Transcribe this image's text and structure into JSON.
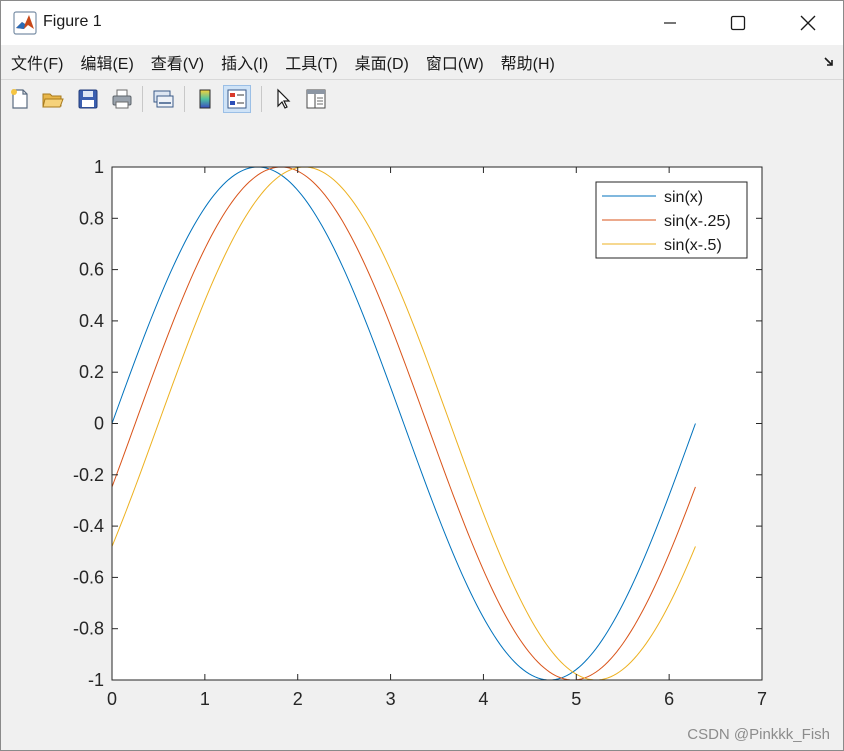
{
  "window": {
    "title": "Figure 1",
    "controls": [
      "minimize-icon",
      "maximize-icon",
      "close-icon"
    ]
  },
  "menubar": {
    "items": [
      {
        "label": "文件(F)"
      },
      {
        "label": "编辑(E)"
      },
      {
        "label": "查看(V)"
      },
      {
        "label": "插入(I)"
      },
      {
        "label": "工具(T)"
      },
      {
        "label": "桌面(D)"
      },
      {
        "label": "窗口(W)"
      },
      {
        "label": "帮助(H)"
      }
    ]
  },
  "toolbar": {
    "buttons": [
      {
        "icon": "new-figure-icon"
      },
      {
        "icon": "open-file-icon"
      },
      {
        "icon": "save-icon"
      },
      {
        "icon": "print-icon"
      },
      {
        "icon": "link-plot-icon"
      },
      {
        "icon": "colorbar-icon"
      },
      {
        "icon": "legend-icon",
        "active": true
      },
      {
        "icon": "edit-plot-pointer-icon"
      },
      {
        "icon": "property-inspector-icon"
      }
    ]
  },
  "chart_data": {
    "type": "line",
    "title": "",
    "xlabel": "",
    "ylabel": "",
    "xlim": [
      0,
      7
    ],
    "ylim": [
      -1,
      1
    ],
    "xticks": [
      "0",
      "1",
      "2",
      "3",
      "4",
      "5",
      "6",
      "7"
    ],
    "yticks": [
      "-1",
      "-0.8",
      "-0.6",
      "-0.4",
      "-0.2",
      "0",
      "0.2",
      "0.4",
      "0.6",
      "0.8",
      "1"
    ],
    "x_range": [
      0,
      6.2832
    ],
    "grid": false,
    "legend_position": "top-right",
    "series": [
      {
        "name": "sin(x)",
        "phase": 0,
        "color": "#0072bd"
      },
      {
        "name": "sin(x-.25)",
        "phase": 0.25,
        "color": "#d95319"
      },
      {
        "name": "sin(x-.5)",
        "phase": 0.5,
        "color": "#edb120"
      }
    ]
  },
  "watermark": "CSDN @Pinkkk_Fish"
}
